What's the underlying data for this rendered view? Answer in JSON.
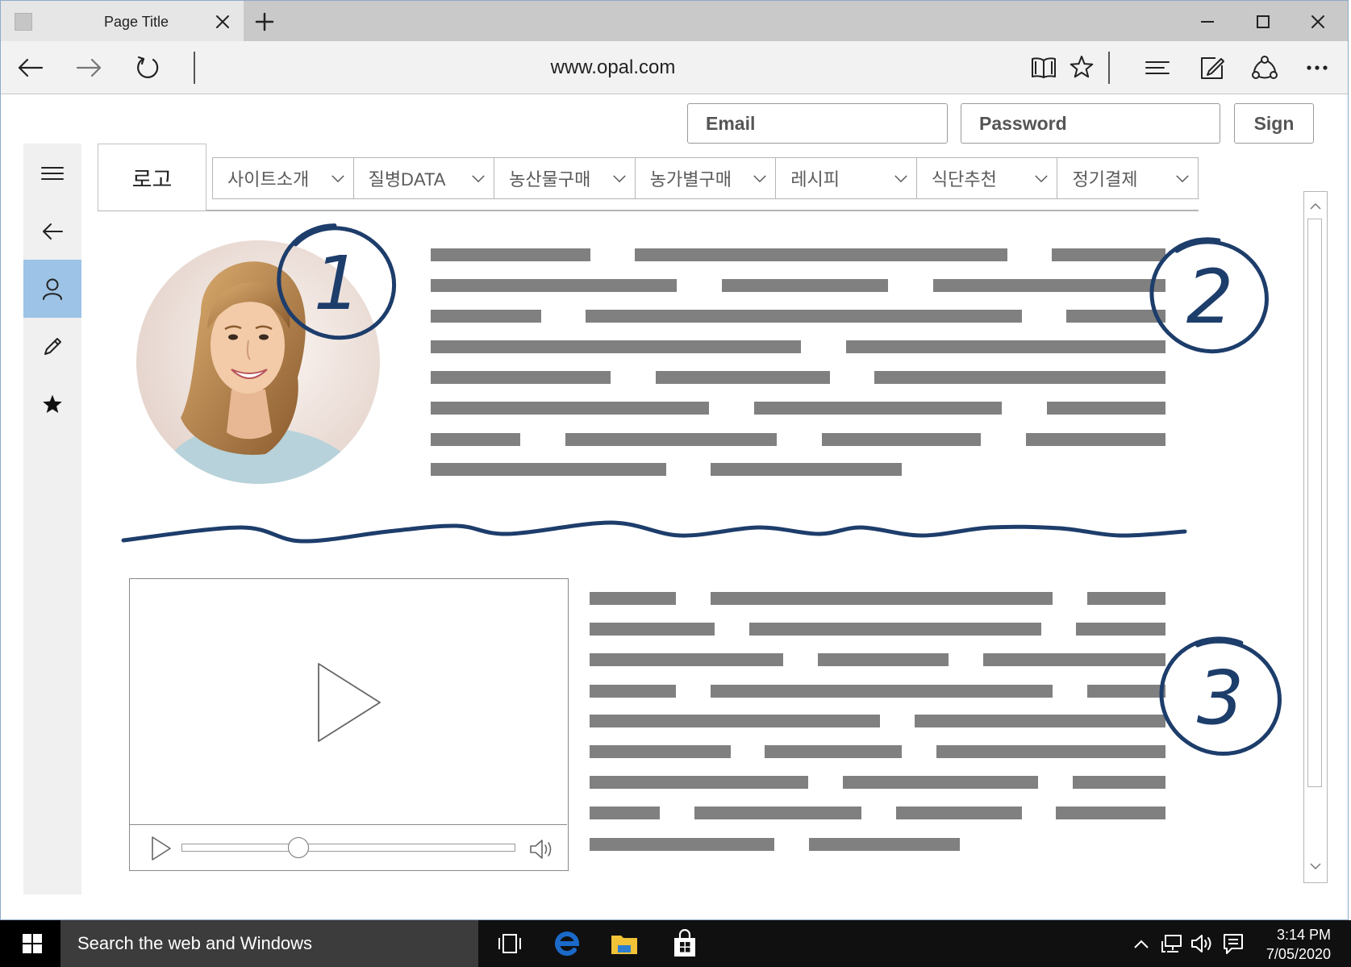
{
  "browser": {
    "tab_title": "Page Title",
    "url": "www.opal.com",
    "icons": [
      "page-icon",
      "tab-close-icon",
      "new-tab-plus-icon",
      "back-arrow-icon",
      "forward-arrow-icon",
      "refresh-icon",
      "reading-view-icon",
      "favorite-star-icon",
      "hub-icon",
      "web-note-icon",
      "share-icon",
      "more-icon"
    ]
  },
  "login": {
    "email_placeholder": "Email",
    "password_placeholder": "Password",
    "sign_label": "Sign"
  },
  "site": {
    "logo_label": "로고",
    "nav": [
      {
        "label": "사이트소개"
      },
      {
        "label": "질병DATA"
      },
      {
        "label": "농산물구매"
      },
      {
        "label": "농가별구매"
      },
      {
        "label": "레시피"
      },
      {
        "label": "식단추천"
      },
      {
        "label": "정기결제"
      }
    ]
  },
  "sidebar": {
    "items": [
      {
        "icon": "menu-icon",
        "active": false
      },
      {
        "icon": "back-arrow-icon",
        "active": false
      },
      {
        "icon": "user-icon",
        "active": true
      },
      {
        "icon": "pencil-icon",
        "active": false
      },
      {
        "icon": "star-icon",
        "active": false
      }
    ]
  },
  "annotations": {
    "first": "1",
    "second": "2",
    "third": "3"
  },
  "video": {
    "progress": 0.35
  },
  "taskbar": {
    "search_placeholder": "Search the web and Windows",
    "time": "3:14 PM",
    "date": "7/05/2020"
  },
  "colors": {
    "active_sidebar": "#9dc3e6",
    "annotation_ink": "#1d3d6b",
    "placeholder_text": "#808080",
    "taskbar": "#101010",
    "edge_blue": "#1b6ac9",
    "folder_yellow": "#f2c237"
  }
}
